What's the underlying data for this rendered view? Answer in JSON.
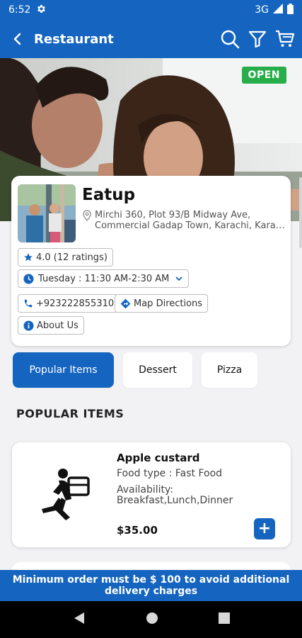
{
  "status": {
    "time": "6:52",
    "network": "3G"
  },
  "app_bar": {
    "title": "Restaurant"
  },
  "hero": {
    "badge": "OPEN"
  },
  "restaurant": {
    "name": "Eatup",
    "address": "Mirchi 360, Plot 93/B Midway Ave,\nCommercial Gadap Town, Karachi, Kara…",
    "rating": "4.0 (12 ratings)",
    "hours": "Tuesday : 11:30 AM-2:30 AM",
    "phone": "+923222855310",
    "directions": "Map Directions",
    "about": "About Us"
  },
  "categories": [
    {
      "label": "Popular Items",
      "active": true
    },
    {
      "label": "Dessert",
      "active": false
    },
    {
      "label": "Pizza",
      "active": false
    }
  ],
  "section": {
    "title": "POPULAR ITEMS"
  },
  "items": [
    {
      "name": "Apple custard",
      "food_type": "Food type : Fast Food",
      "availability_label": "Availability:",
      "availability": "Breakfast,Lunch,Dinner",
      "price": "$35.00",
      "add": "+"
    }
  ],
  "banner": {
    "text": "Minimum order must be $ 100 to avoid additional delivery charges"
  },
  "colors": {
    "primary": "#1565c0",
    "open": "#27ae4a",
    "background": "#f2f2f4"
  }
}
